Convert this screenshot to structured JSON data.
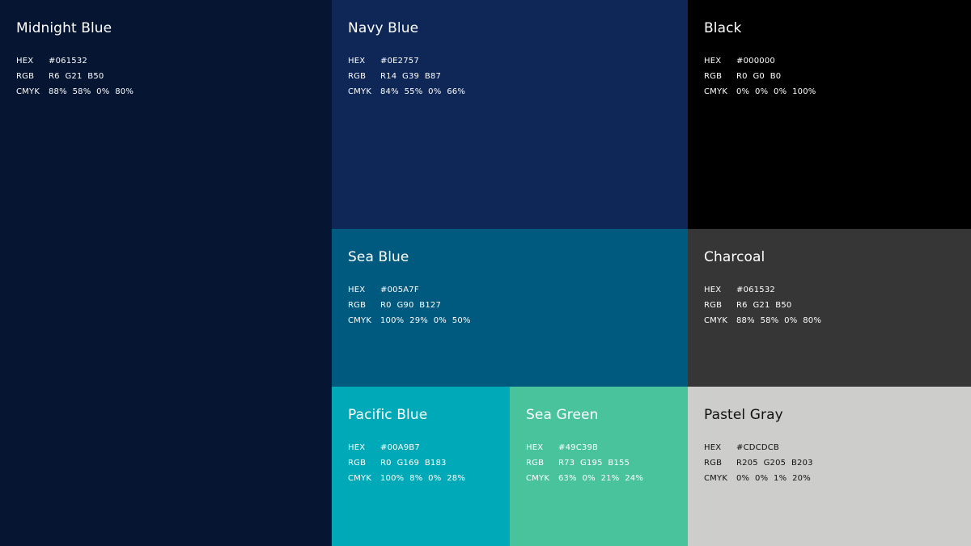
{
  "swatches": {
    "midnight": {
      "name": "Midnight Blue",
      "color": "#061532",
      "hex_label": "HEX",
      "hex": "#061532",
      "rgb_label": "RGB",
      "rgb": "R6  G21  B50",
      "cmyk_label": "CMYK",
      "cmyk": "88%  58%  0%  80%"
    },
    "navy": {
      "name": "Navy Blue",
      "color": "#0E2757",
      "hex_label": "HEX",
      "hex": "#0E2757",
      "rgb_label": "RGB",
      "rgb": "R14  G39  B87",
      "cmyk_label": "CMYK",
      "cmyk": "84%  55%  0%  66%"
    },
    "black": {
      "name": "Black",
      "color": "#000000",
      "hex_label": "HEX",
      "hex": "#000000",
      "rgb_label": "RGB",
      "rgb": "R0  G0  B0",
      "cmyk_label": "CMYK",
      "cmyk": "0%  0%  0%  100%"
    },
    "seablue": {
      "name": "Sea Blue",
      "color": "#005A7F",
      "hex_label": "HEX",
      "hex": "#005A7F",
      "rgb_label": "RGB",
      "rgb": "R0  G90  B127",
      "cmyk_label": "CMYK",
      "cmyk": "100%  29%  0%  50%"
    },
    "charcoal": {
      "name": "Charcoal",
      "color": "#363636",
      "hex_label": "HEX",
      "hex": "#061532",
      "rgb_label": "RGB",
      "rgb": "R6  G21  B50",
      "cmyk_label": "CMYK",
      "cmyk": "88%  58%  0%  80%"
    },
    "pacific": {
      "name": "Pacific Blue",
      "color": "#00A9B7",
      "hex_label": "HEX",
      "hex": "#00A9B7",
      "rgb_label": "RGB",
      "rgb": "R0  G169  B183",
      "cmyk_label": "CMYK",
      "cmyk": "100%  8%  0%  28%"
    },
    "seagreen": {
      "name": "Sea Green",
      "color": "#49C39B",
      "hex_label": "HEX",
      "hex": "#49C39B",
      "rgb_label": "RGB",
      "rgb": "R73  G195  B155",
      "cmyk_label": "CMYK",
      "cmyk": "63%  0%  21%  24%"
    },
    "pastel": {
      "name": "Pastel Gray",
      "color": "#CDCDCB",
      "hex_label": "HEX",
      "hex": "#CDCDCB",
      "rgb_label": "RGB",
      "rgb": "R205  G205  B203",
      "cmyk_label": "CMYK",
      "cmyk": "0%  0%  1%  20%"
    }
  }
}
